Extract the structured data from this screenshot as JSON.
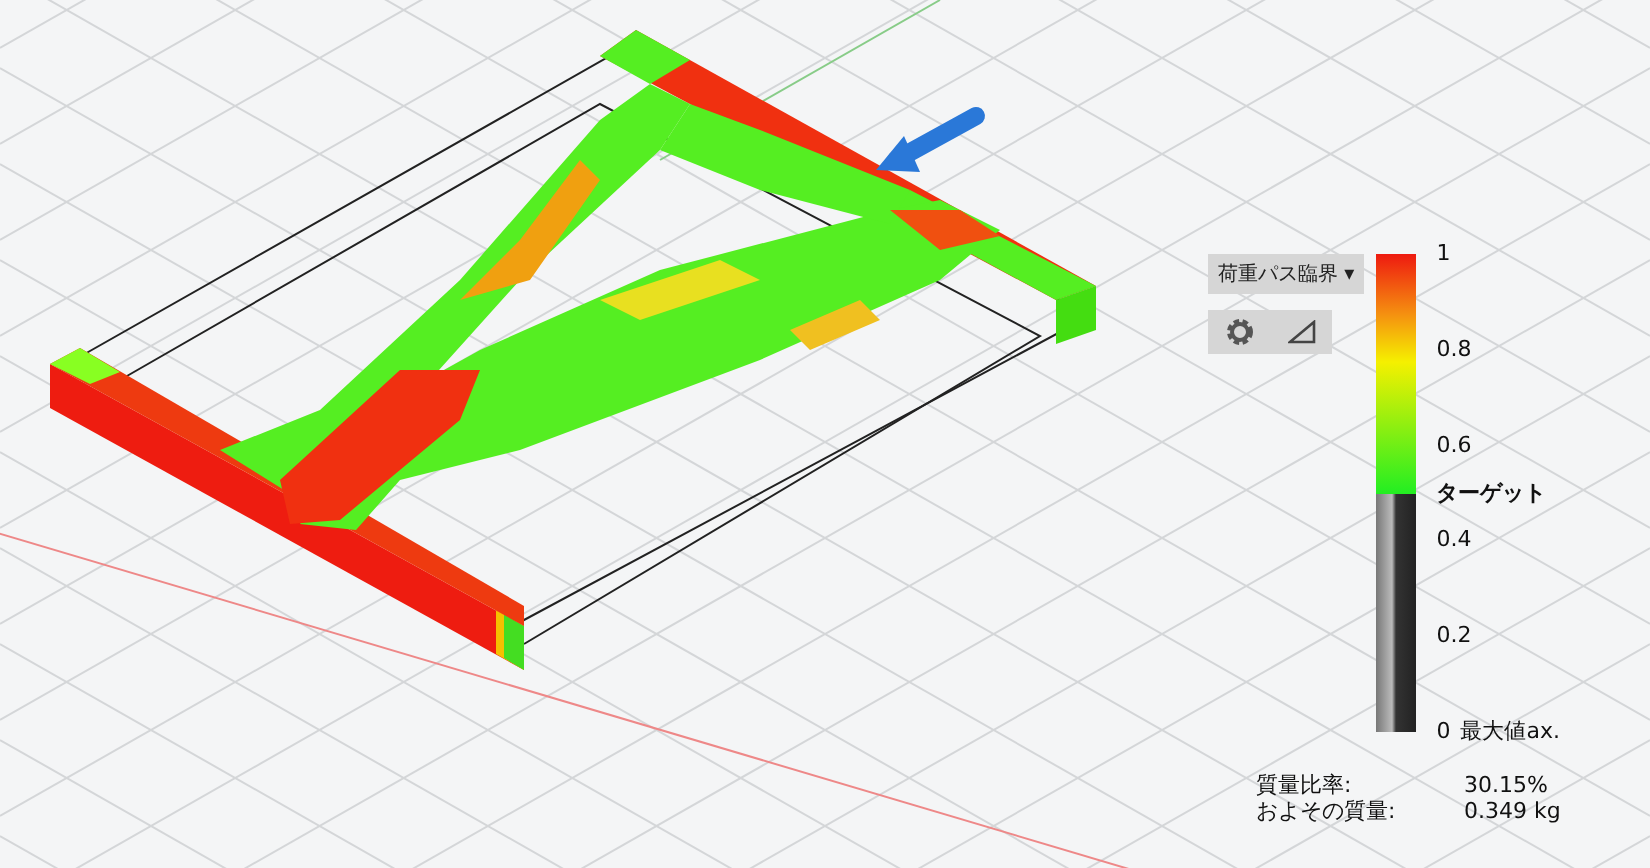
{
  "legend": {
    "mode": "荷重パス臨界",
    "caret": "▾",
    "ticks": [
      "1",
      "0.8",
      "0.6",
      "0.4",
      "0.2",
      "0"
    ],
    "target": {
      "label": "ターゲット",
      "level": 0.5
    },
    "max_label": "最大値ax."
  },
  "stats": [
    {
      "label": "質量比率:",
      "value": "30.15%"
    },
    {
      "label": "およその質量:",
      "value": "0.349 kg"
    }
  ]
}
